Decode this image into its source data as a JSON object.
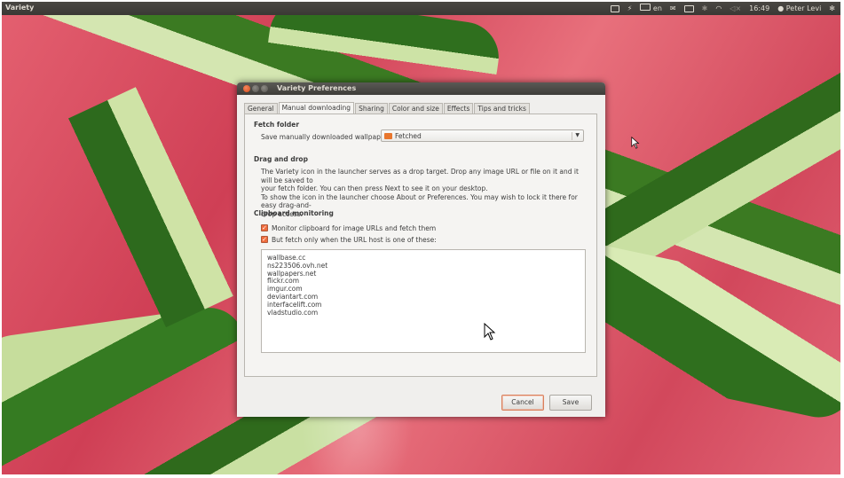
{
  "topbar": {
    "app_title": "Variety",
    "keyboard_layout": "en",
    "time": "16:49",
    "user": "Peter Levi",
    "icons": [
      "screen-icon",
      "flash-icon",
      "keyboard-icon",
      "mail-icon",
      "battery-icon",
      "bluetooth-icon",
      "wifi-icon",
      "volume-icon",
      "user-icon",
      "gear-icon"
    ]
  },
  "window": {
    "title": "Variety Preferences",
    "tabs": [
      "General",
      "Manual downloading",
      "Sharing",
      "Color and size",
      "Effects",
      "Tips and tricks"
    ],
    "active_tab": "Manual downloading",
    "fetch_folder": {
      "heading": "Fetch folder",
      "label": "Save manually downloaded wallpapers to",
      "value": "Fetched"
    },
    "drag_drop": {
      "heading": "Drag and drop",
      "line1": "The Variety icon in the launcher serves as a drop target. Drop any image URL or file on it and it will be saved to",
      "line2": "your fetch folder. You can then press Next to see it on your desktop.",
      "line3": "To show the icon in the launcher choose About or Preferences. You may wish to lock it there for easy drag-and-",
      "line4": "drop access."
    },
    "clipboard": {
      "heading": "Clipboard monitoring",
      "monitor_label": "Monitor clipboard for image URLs and fetch them",
      "monitor_checked": true,
      "fetch_only_label": "But fetch only when the URL host is one of these:",
      "fetch_only_checked": true,
      "hosts": [
        "wallbase.cc",
        "ns223506.ovh.net",
        "wallpapers.net",
        "flickr.com",
        "imgur.com",
        "deviantart.com",
        "interfacelift.com",
        "vladstudio.com"
      ]
    },
    "buttons": {
      "cancel": "Cancel",
      "save": "Save"
    }
  },
  "colors": {
    "accent": "#f06b3c",
    "topbar": "#3c3b37",
    "window_bg": "#f0efed"
  }
}
